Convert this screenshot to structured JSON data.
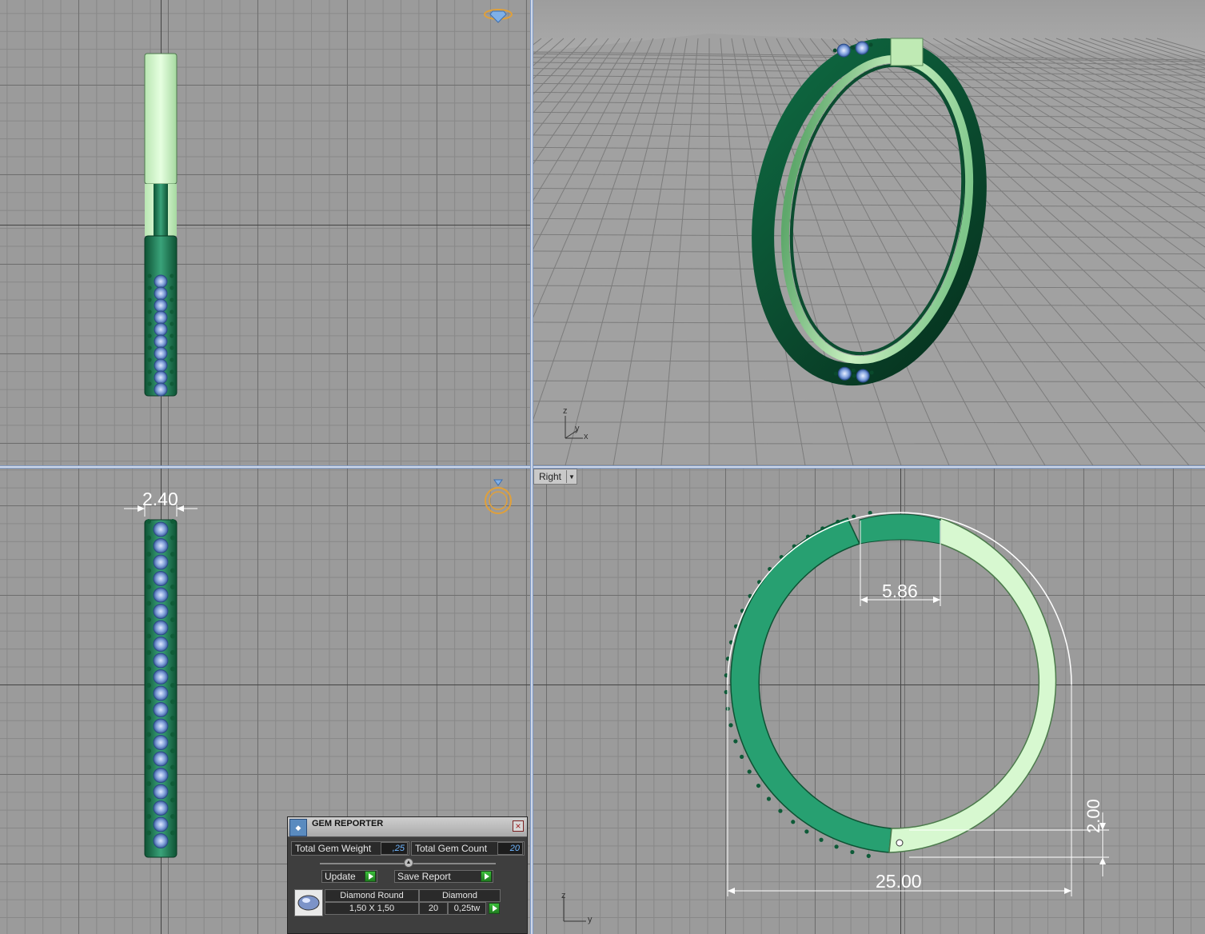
{
  "viewports": {
    "top_left": {
      "name": "front-view"
    },
    "top_right": {
      "name": "perspective-view",
      "axis": {
        "z": "z",
        "y": "y",
        "x": "x"
      }
    },
    "bottom_left": {
      "name": "side-view",
      "dimension": "2.40"
    },
    "bottom_right": {
      "label": "Right",
      "dimensions": {
        "gap_width": "5.86",
        "outer_diameter": "25.00",
        "hinge_height": "2.00"
      },
      "axis": {
        "z": "z",
        "y": "y"
      }
    }
  },
  "gem_reporter": {
    "title": "GEM REPORTER",
    "total_weight_label": "Total Gem Weight",
    "total_weight_value": ",25",
    "total_count_label": "Total Gem Count",
    "total_count_value": "20",
    "update_label": "Update",
    "save_report_label": "Save Report",
    "rows": [
      {
        "shape": "Diamond Round",
        "size": "1,50 X 1,50",
        "material": "Diamond",
        "count": "20",
        "weight": "0,25tw"
      }
    ]
  },
  "colors": {
    "ring_dark": "#1f7a54",
    "ring_light": "#d6f5d0",
    "gem_blue": "#8fb2e8",
    "grid_bg": "#9b9b9b",
    "viewport_separator": "#7f9bc8"
  }
}
